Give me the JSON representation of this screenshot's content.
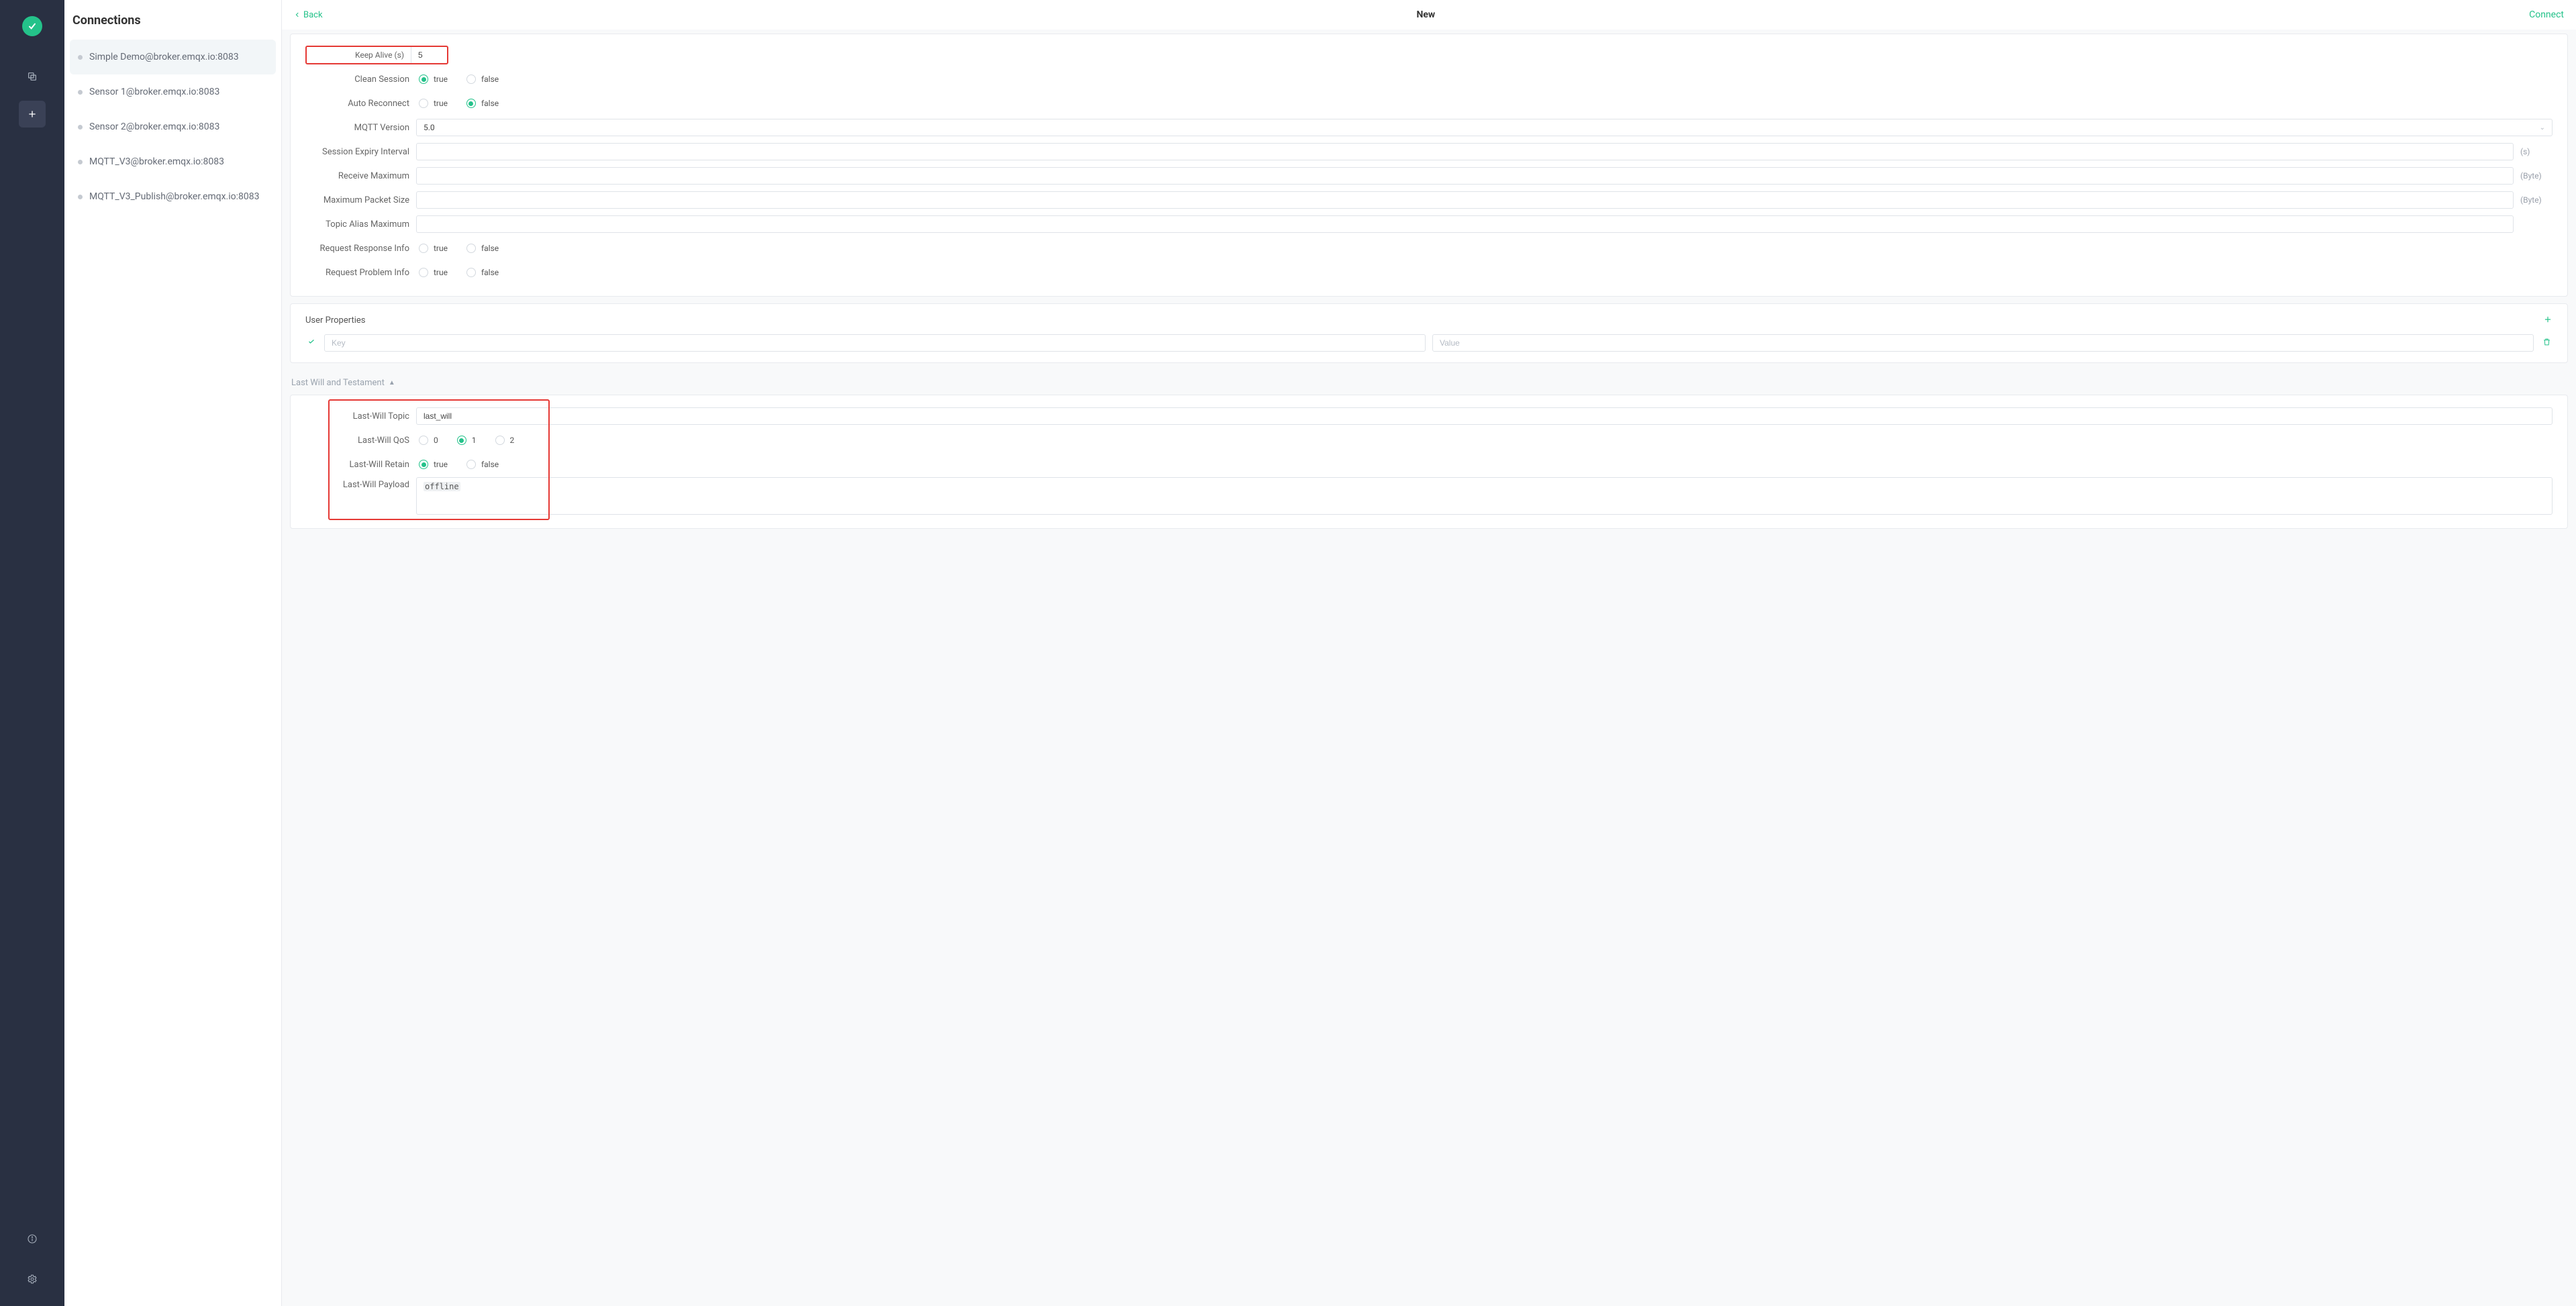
{
  "app": {
    "connections_title": "Connections"
  },
  "sidebar": {
    "items": [
      {
        "label": "Simple Demo@broker.emqx.io:8083",
        "active": true
      },
      {
        "label": "Sensor 1@broker.emqx.io:8083",
        "active": false
      },
      {
        "label": "Sensor 2@broker.emqx.io:8083",
        "active": false
      },
      {
        "label": "MQTT_V3@broker.emqx.io:8083",
        "active": false
      },
      {
        "label": "MQTT_V3_Publish@broker.emqx.io:8083",
        "active": false
      }
    ]
  },
  "header": {
    "back_label": "Back",
    "title": "New",
    "connect_label": "Connect"
  },
  "form": {
    "keep_alive_label": "Keep Alive (s)",
    "keep_alive_value": "5",
    "clean_session_label": "Clean Session",
    "auto_reconnect_label": "Auto Reconnect",
    "mqtt_version_label": "MQTT Version",
    "mqtt_version_value": "5.0",
    "session_expiry_label": "Session Expiry Interval",
    "session_expiry_unit": "(s)",
    "receive_max_label": "Receive Maximum",
    "receive_max_unit": "(Byte)",
    "max_packet_label": "Maximum Packet Size",
    "max_packet_unit": "(Byte)",
    "topic_alias_label": "Topic Alias Maximum",
    "req_response_label": "Request Response Info",
    "req_problem_label": "Request Problem Info",
    "clean_session_value": "true",
    "auto_reconnect_value": "false",
    "req_response_value": null,
    "req_problem_value": null,
    "radio": {
      "true": "true",
      "false": "false",
      "0": "0",
      "1": "1",
      "2": "2"
    }
  },
  "user_properties": {
    "title": "User Properties",
    "key_placeholder": "Key",
    "value_placeholder": "Value"
  },
  "lwt": {
    "section_title": "Last Will and Testament",
    "topic_label": "Last-Will Topic",
    "topic_value": "last_will",
    "qos_label": "Last-Will QoS",
    "qos_value": "1",
    "retain_label": "Last-Will Retain",
    "retain_value": "true",
    "payload_label": "Last-Will Payload",
    "payload_value": "offline"
  }
}
